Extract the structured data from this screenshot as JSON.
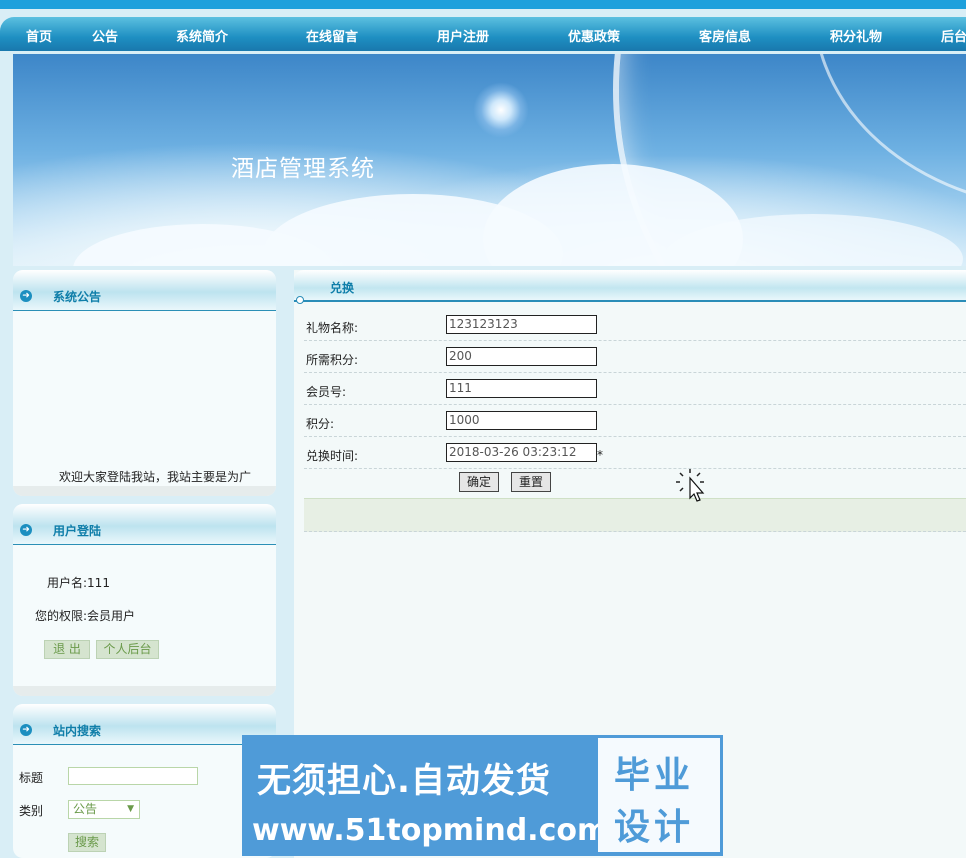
{
  "nav": {
    "items": [
      "首页",
      "公告",
      "系统简介",
      "在线留言",
      "用户注册",
      "优惠政策",
      "客房信息",
      "积分礼物",
      "后台"
    ]
  },
  "banner": {
    "title": "酒店管理系统"
  },
  "notice_panel": {
    "title": "系统公告",
    "marquee_text": "欢迎大家登陆我站，我站主要是为广"
  },
  "login_panel": {
    "title": "用户登陆",
    "username": "用户名:111",
    "permission": "您的权限:会员用户",
    "logout_label": "退 出",
    "personal_label": "个人后台"
  },
  "search_panel": {
    "title": "站内搜索",
    "title_label": "标题",
    "title_value": "",
    "category_label": "类别",
    "category_value": "公告",
    "search_label": "搜索"
  },
  "exchange": {
    "heading": "兑换",
    "fields": [
      {
        "label": "礼物名称:",
        "value": "123123123"
      },
      {
        "label": "所需积分:",
        "value": "200"
      },
      {
        "label": "会员号:",
        "value": "111"
      },
      {
        "label": "积分:",
        "value": "1000"
      },
      {
        "label": "兑换时间:",
        "value": "2018-03-26 03:23:12"
      }
    ],
    "required_mark": "*",
    "confirm_label": "确定",
    "reset_label": "重置"
  },
  "watermark": {
    "line1": "无须担心.自动发货",
    "line2": "www.51topmind.com",
    "box_line1": "毕业",
    "box_line2": "设计"
  }
}
